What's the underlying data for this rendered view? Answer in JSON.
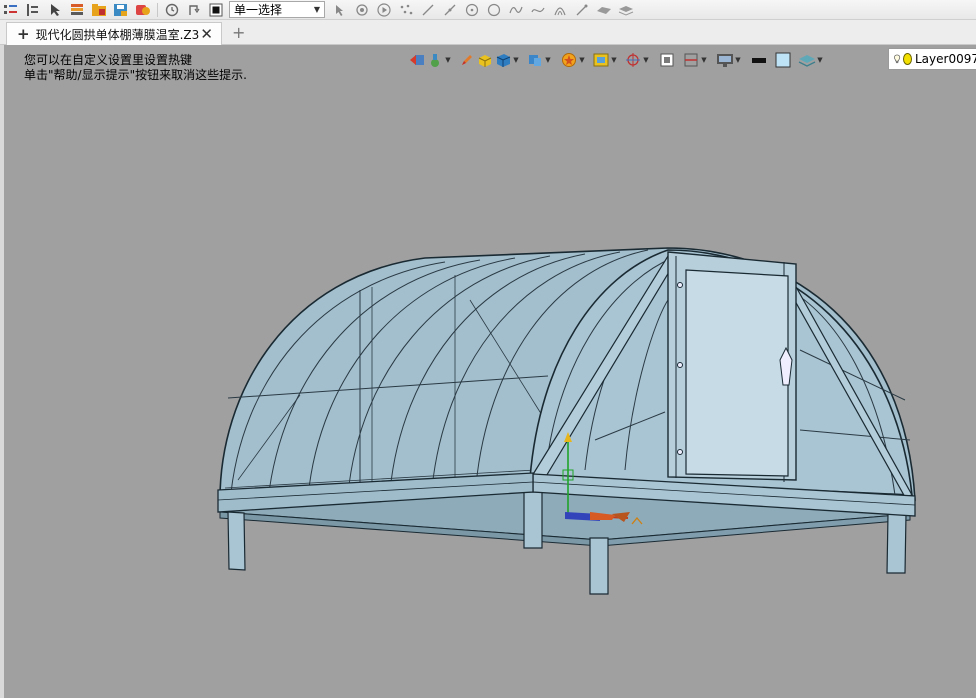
{
  "toolbar": {
    "selection_mode": "单一选择",
    "icons": [
      "list-icon",
      "list-indent-icon",
      "cursor-icon",
      "stack-icon",
      "folder-icon",
      "save-icon",
      "settings-icon",
      "history-icon",
      "undo-icon",
      "stop-icon"
    ],
    "tool_icons": [
      "pick-arrow-icon",
      "select-filter-icon",
      "play-icon",
      "points-icon",
      "line-icon",
      "segment-icon",
      "circle-center-icon",
      "circle-icon",
      "curve-icon",
      "spline-icon",
      "arc-icon",
      "arrow-icon",
      "surface-icon",
      "layers-icon"
    ]
  },
  "tab": {
    "title": "现代化圆拱单体棚薄膜温室.Z3",
    "plus_label": "+",
    "close_label": "✕",
    "new_tab_label": "+"
  },
  "viewport": {
    "hint_line1": "您可以在自定义设置里设置热键",
    "hint_line2": "单击\"帮助/显示提示\"按钮来取消这些提示.",
    "icons": [
      "back-arrow-icon",
      "view-orient-icon",
      "pencil-icon",
      "box-yellow-icon",
      "cube-shaded-icon",
      "cube-blue-icon",
      "star-icon",
      "frame-icon",
      "target-icon",
      "zoom-fit-icon",
      "section-icon",
      "display-icon",
      "black-color-swatch-icon",
      "light-blue-swatch-icon",
      "layer-stack-icon"
    ],
    "layer": {
      "name": "Layer0097"
    }
  },
  "colors": {
    "background": "#a0a0a0",
    "model_fill": "#a9c4d2",
    "model_line": "#1a2a33",
    "accent_yellow": "#f3e000"
  }
}
